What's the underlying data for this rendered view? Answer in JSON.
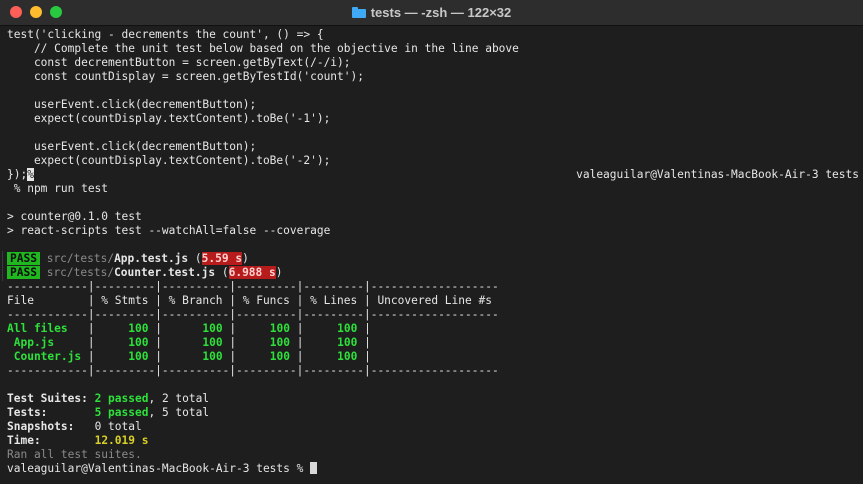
{
  "window": {
    "title": "tests — -zsh — 122×32",
    "icon": "folder-icon"
  },
  "code": [
    "test('clicking - decrements the count', () => {",
    "    // Complete the unit test below based on the objective in the line above",
    "    const decrementButton = screen.getByText(/-/i);",
    "    const countDisplay = screen.getByTestId('count');",
    "",
    "    userEvent.click(decrementButton);",
    "    expect(countDisplay.textContent).toBe('-1');",
    "",
    "    userEvent.click(decrementButton);",
    "    expect(countDisplay.textContent).toBe('-2');",
    "});"
  ],
  "eof_marker": "%",
  "prompt_right": "valeaguilar@Valentinas-MacBook-Air-3 tests",
  "command": " % npm run test",
  "npm_output": [
    "> counter@0.1.0 test",
    "> react-scripts test --watchAll=false --coverage"
  ],
  "results": [
    {
      "status": "PASS",
      "dir": "src/tests/",
      "file": "App.test.js",
      "time": "5.59 s"
    },
    {
      "status": "PASS",
      "dir": "src/tests/",
      "file": "Counter.test.js",
      "time": "6.988 s"
    }
  ],
  "coverage": {
    "separator": "------------|---------|----------|---------|---------|-------------------",
    "header": "File        | % Stmts | % Branch | % Funcs | % Lines | Uncovered Line #s ",
    "rows": [
      {
        "file": "All files  ",
        "stmts": "100",
        "branch": "100",
        "funcs": "100",
        "lines": "100"
      },
      {
        "file": " App.js    ",
        "stmts": "100",
        "branch": "100",
        "funcs": "100",
        "lines": "100"
      },
      {
        "file": " Counter.js",
        "stmts": "100",
        "branch": "100",
        "funcs": "100",
        "lines": "100"
      }
    ]
  },
  "summary": {
    "suites_label": "Test Suites:",
    "suites_passed": "2 passed",
    "suites_total": ", 2 total",
    "tests_label": "Tests:",
    "tests_passed": "5 passed",
    "tests_total": ", 5 total",
    "snapshots_label": "Snapshots:",
    "snapshots_value": "0 total",
    "time_label": "Time:",
    "time_value": "12.019 s",
    "ran_all": "Ran all test suites."
  },
  "final_prompt": "valeaguilar@Valentinas-MacBook-Air-3 tests % "
}
